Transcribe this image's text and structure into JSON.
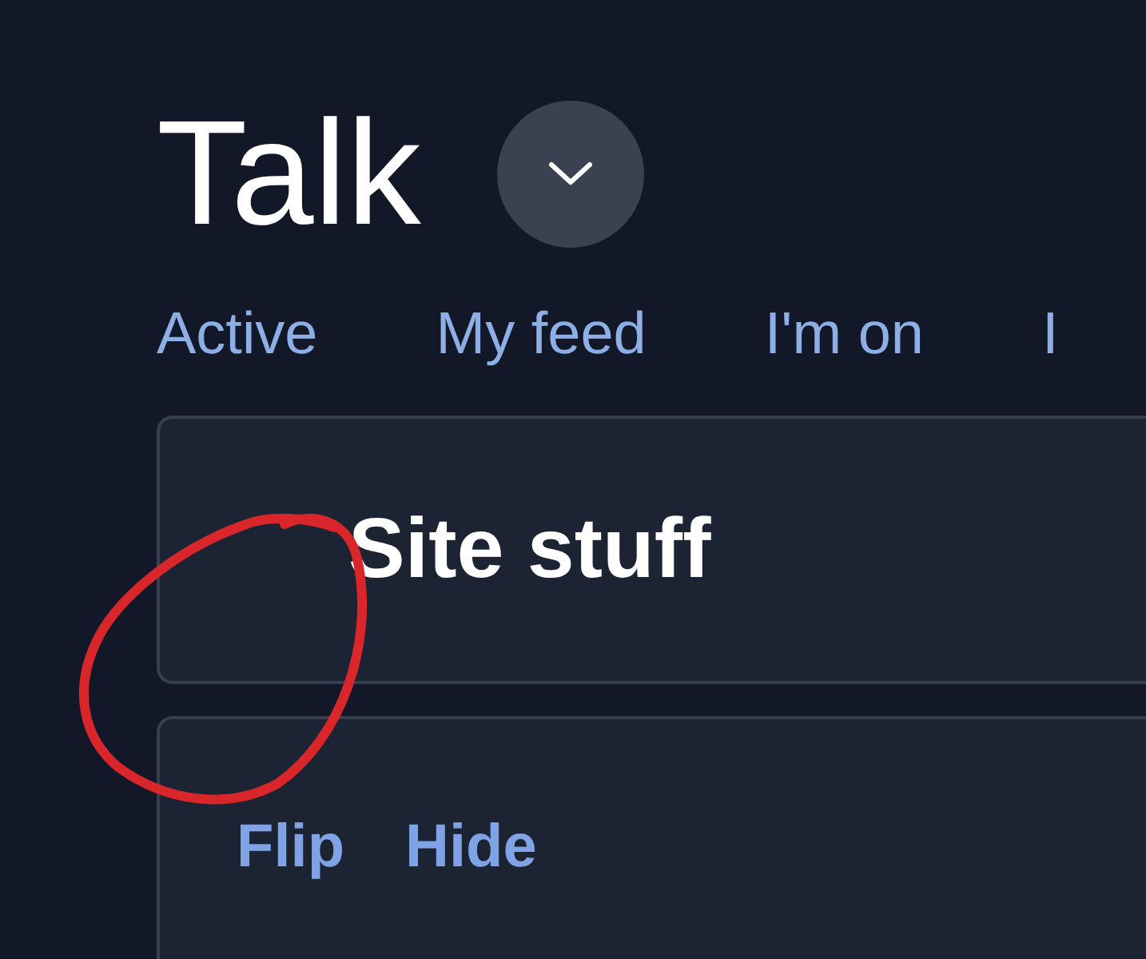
{
  "page": {
    "title": "Talk"
  },
  "tabs": [
    {
      "label": "Active"
    },
    {
      "label": "My feed"
    },
    {
      "label": "I'm on"
    },
    {
      "label": "I"
    }
  ],
  "cards": [
    {
      "kind": "heading",
      "title": "Site stuff"
    },
    {
      "kind": "actions",
      "actions": [
        "Flip",
        "Hide"
      ]
    }
  ]
}
